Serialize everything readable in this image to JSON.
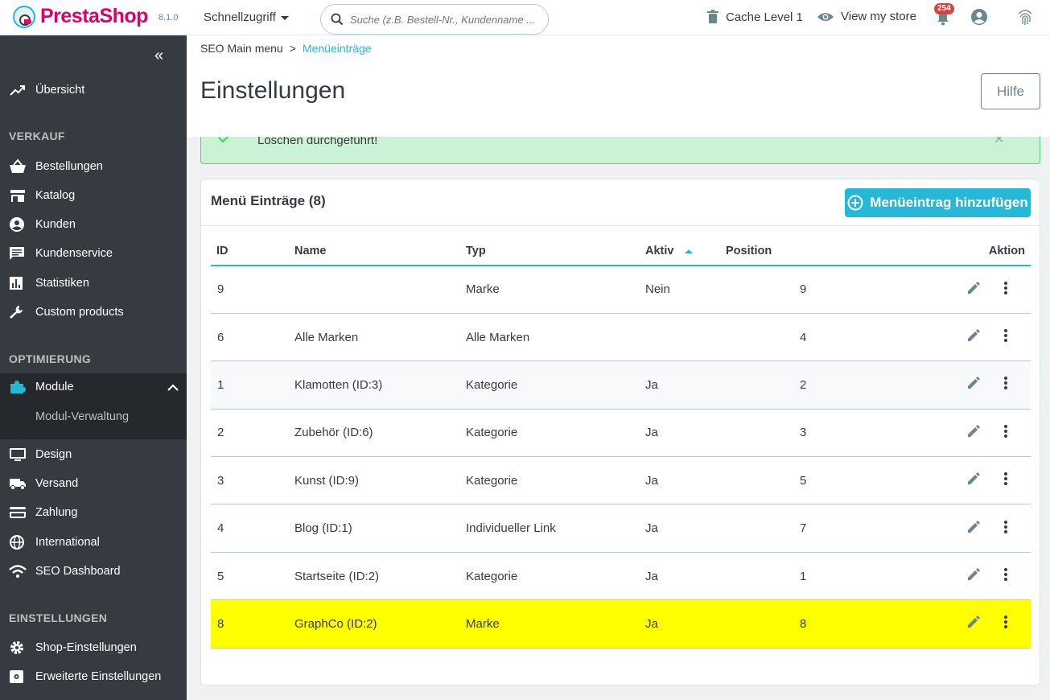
{
  "header": {
    "brand": "PrestaShop",
    "version": "8.1.0",
    "quick_access": "Schnellzugriff",
    "search_placeholder": "Suche (z.B. Bestell-Nr., Kundenname ...",
    "cache": "Cache Level 1",
    "view_store": "View my store",
    "notifications": "254"
  },
  "sidebar": {
    "overview": "Übersicht",
    "sections": [
      "VERKAUF",
      "OPTIMIERUNG",
      "EINSTELLUNGEN"
    ],
    "sales_items": [
      "Bestellungen",
      "Katalog",
      "Kunden",
      "Kundenservice",
      "Statistiken",
      "Custom products"
    ],
    "optim_items": [
      "Module",
      "Design",
      "Versand",
      "Zahlung",
      "International",
      "SEO Dashboard"
    ],
    "module_sub": "Modul-Verwaltung",
    "settings_items": [
      "Shop-Einstellungen",
      "Erweiterte Einstellungen"
    ]
  },
  "page": {
    "breadcrumb_root": "SEO Main menu",
    "breadcrumb_sep": ">",
    "breadcrumb_current": "Menüeinträge",
    "title": "Einstellungen",
    "help": "Hilfe",
    "alert": "Löschen durchgeführt!"
  },
  "panel": {
    "title": "Menü Einträge (8)",
    "add_button": "Menüeintrag hinzufügen",
    "columns": [
      "ID",
      "Name",
      "Typ",
      "Aktiv",
      "Position",
      "Aktion"
    ],
    "rows": [
      {
        "id": "9",
        "name": "",
        "typ": "Marke",
        "aktiv": "Nein",
        "pos": "9"
      },
      {
        "id": "6",
        "name": "Alle Marken",
        "typ": "Alle Marken",
        "aktiv": "",
        "pos": "4"
      },
      {
        "id": "1",
        "name": "Klamotten (ID:3)",
        "typ": "Kategorie",
        "aktiv": "Ja",
        "pos": "2"
      },
      {
        "id": "2",
        "name": "Zubehör (ID:6)",
        "typ": "Kategorie",
        "aktiv": "Ja",
        "pos": "3"
      },
      {
        "id": "3",
        "name": "Kunst (ID:9)",
        "typ": "Kategorie",
        "aktiv": "Ja",
        "pos": "5"
      },
      {
        "id": "4",
        "name": "Blog (ID:1)",
        "typ": "Individueller Link",
        "aktiv": "Ja",
        "pos": "7"
      },
      {
        "id": "5",
        "name": "Startseite (ID:2)",
        "typ": "Kategorie",
        "aktiv": "Ja",
        "pos": "1"
      },
      {
        "id": "8",
        "name": "GraphCo (ID:2)",
        "typ": "Marke",
        "aktiv": "Ja",
        "pos": "8"
      }
    ]
  },
  "colors": {
    "accent": "#25b9d7",
    "brand": "#df0067",
    "sidebar_bg": "#363a41",
    "highlight": "#ffff00",
    "success_bg": "#cbf2d4"
  }
}
